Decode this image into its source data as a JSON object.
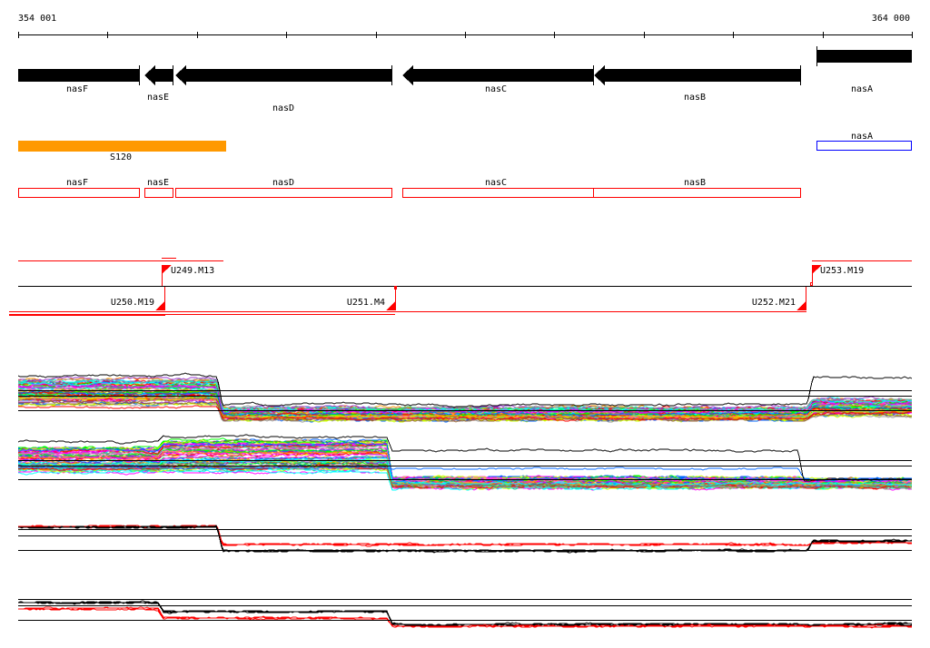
{
  "ruler": {
    "start_label": "354 001",
    "end_label": "364 000"
  },
  "genes": [
    {
      "name": "nasF",
      "strand": "+"
    },
    {
      "name": "nasE",
      "strand": "-"
    },
    {
      "name": "nasD",
      "strand": "-"
    },
    {
      "name": "nasC",
      "strand": "-"
    },
    {
      "name": "nasB",
      "strand": "-"
    },
    {
      "name": "nasA",
      "strand": "+"
    }
  ],
  "regulon": {
    "label": "S120",
    "color": "#ff9900"
  },
  "operon_boxes": {
    "forward_label": "nasA",
    "forward_color": "#0000ff",
    "reverse_color": "#ff0000",
    "reverse_labels": [
      "nasF",
      "nasE",
      "nasD",
      "nasC",
      "nasB"
    ]
  },
  "transcription_units": [
    "U249.M13",
    "U250.M19",
    "U251.M4",
    "U252.M21",
    "U253.M19"
  ],
  "expression_palette": [
    "#ff0000",
    "#0066ff",
    "#00ff00",
    "#ff00ff",
    "#00ffff",
    "#ccff00",
    "#ff9900",
    "#999999",
    "#9933cc",
    "#996633",
    "#ff66cc",
    "#33cc99"
  ]
}
